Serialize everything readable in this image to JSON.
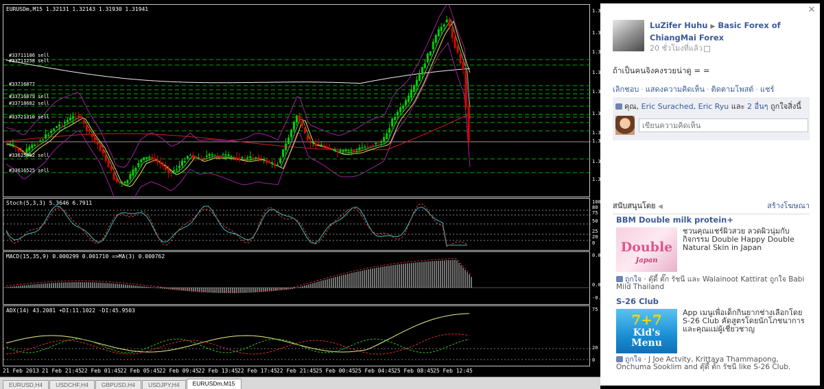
{
  "chart": {
    "main_label": "EURUSDm,M15  1.32131 1.32143 1.31930 1.31941",
    "orders": [
      "#33711186 sell",
      "#33711258 sell",
      "#33716877",
      "#33716879 sell",
      "#33718682 sell",
      "#33721310 sell",
      "#33625062 sell",
      "#33616525 sell"
    ],
    "price_axis": [
      "1.3",
      "1.3",
      "1.3",
      "1.3",
      "1.3",
      "1.3",
      "1.3",
      "1.3",
      "1.3",
      "1.3"
    ],
    "stoch_label": "Stoch(5,3,3) 5.3646 6.7911",
    "stoch_axis": [
      "100",
      "80",
      "75",
      "50",
      "25",
      "20",
      "0"
    ],
    "macd_label": "MACD(15,35,9) 0.000299 0.001710  =>MA(3) 0.000762",
    "macd_axis": [
      "0.0",
      "0.0",
      "-0.0"
    ],
    "adx_label": "ADX(14) 43.2081 +DI:11.1022 -DI:45.9503",
    "adx_axis": [
      "75",
      "20",
      "0"
    ],
    "dates": [
      "21 Feb 2013",
      "21 Feb 21:45",
      "22 Feb 01:45",
      "22 Feb 05:45",
      "22 Feb 09:45",
      "22 Feb 13:45",
      "22 Feb 17:45",
      "22 Feb 21:45",
      "25 Feb 00:45",
      "25 Feb 04:45",
      "25 Feb 08:45",
      "25 Feb 12:45"
    ],
    "tabs": [
      "EURUSD,H4",
      "USDCHF,H4",
      "GBPUSD,H4",
      "USDJPY,H4",
      "EURUSDm,M15"
    ],
    "active_tab": 4
  },
  "fb": {
    "author": "LuZifer Huhu",
    "group": "Basic Forex of ChiangMai Forex",
    "time": "20 ชั่วโมงที่แล้ว",
    "text": "ถ้าเป็นคนจิงคงรวยน่าดู = =",
    "actions": [
      "เลิกชอบ",
      "แสดงความคิดเห็น",
      "ติดตามโพสต์",
      "แชร์"
    ],
    "likes": {
      "you": "คุณ,",
      "p1": "Eric Surached,",
      "p2": "Eric Ryu",
      "and": "และ",
      "others": "2 อื่นๆ",
      "suffix": "ถูกใจสิ่งนี้"
    },
    "comment_placeholder": "เขียนความคิดเห็น",
    "ads_title": "สนับสนุนโดย",
    "ads_create": "สร้างโฆษณา",
    "ads": [
      {
        "name": "BBM Double milk protein+",
        "text": "ชวนคุณแชร์ผิวสวย ลวดผิวนุ่มกับ กิจกรรม Double Happy Double Natural Skin in Japan",
        "img_word": "Double",
        "img_sub": "Japan",
        "like": "ถูกใจ",
        "social": "· ตุ๊ดี้ ตั๊ก รัชนี และ Walainoot Kattirat ถูกใจ Babi Mild Thailand"
      },
      {
        "name": "S-26 Club",
        "text": "App เมนูเพื่อเด็กกินยากช่างเลือกโดย S-26 Club คัดสูตรโดยนักโภชนาการ และคุณแม่ผู้เชี่ยวชาญ",
        "img_word": "7+7",
        "img_sub": "Kid's Menu",
        "like": "ถูกใจ",
        "social": "· J Joe Actvity, Krittaya Thammapong, Onchuma Sooklim and ตุ๊ดี้ ตั๊ก รัชนี like S-26 Club."
      }
    ]
  },
  "colors": {
    "bull": "#00d000",
    "bear": "#e00000",
    "fb_link": "#3b5998"
  }
}
